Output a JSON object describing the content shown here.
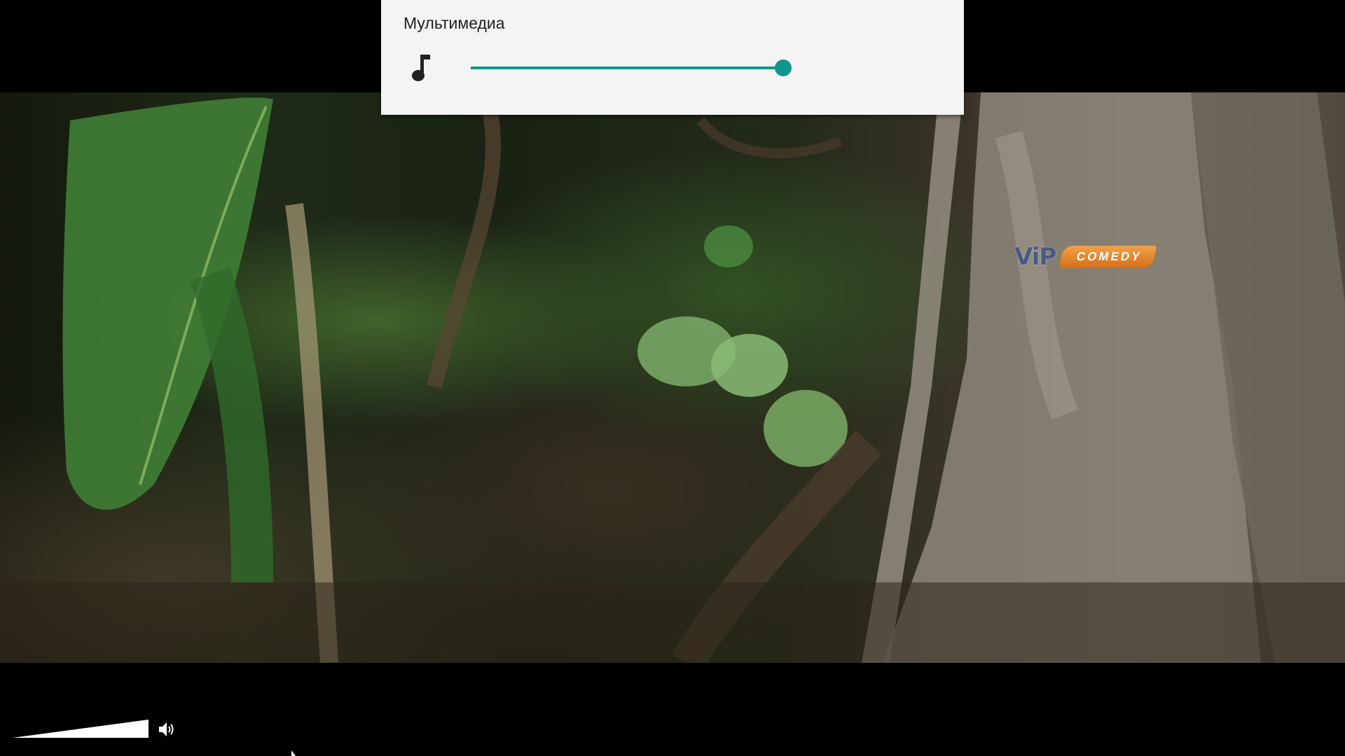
{
  "volume_panel": {
    "title": "Мультимедиа",
    "stream_icon": "music-note-icon",
    "level": 1.0,
    "accent_color": "#10968a"
  },
  "channel_logo": {
    "vip_text": "ViP",
    "comedy_text": "COMEDY"
  },
  "player_controls": {
    "volume_level": 1.0,
    "speaker_icon": "speaker-icon"
  }
}
